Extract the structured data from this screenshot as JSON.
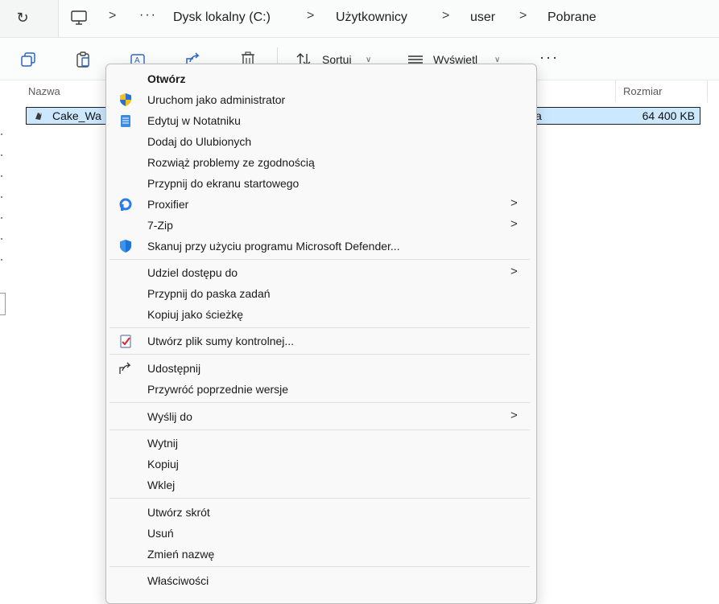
{
  "address": {
    "crumbs": [
      "Dysk lokalny (C:)",
      "Użytkownicy",
      "user",
      "Pobrane"
    ],
    "separator": ">",
    "more": "···"
  },
  "toolbar": {
    "sort_label": "Sortuj",
    "view_label": "Wyświetl",
    "more": "···"
  },
  "columns": {
    "name": "Nazwa",
    "size": "Rozmiar"
  },
  "file": {
    "name": "Cake_Wa",
    "type_fragment": "a",
    "size": "64 400 KB"
  },
  "menu": {
    "items": [
      {
        "label": "Otwórz",
        "bold": true
      },
      {
        "label": "Uruchom jako administrator",
        "icon": "uac-shield-icon"
      },
      {
        "label": "Edytuj w Notatniku",
        "icon": "notepad-icon"
      },
      {
        "label": "Dodaj do Ulubionych"
      },
      {
        "label": "Rozwiąż problemy ze zgodnością"
      },
      {
        "label": "Przypnij do ekranu startowego"
      },
      {
        "label": "Proxifier",
        "icon": "proxifier-icon",
        "submenu": true
      },
      {
        "label": "7-Zip",
        "submenu": true
      },
      {
        "label": "Skanuj przy użyciu programu Microsoft Defender...",
        "icon": "defender-shield-icon"
      },
      {
        "label": "Udziel dostępu do",
        "submenu": true
      },
      {
        "label": "Przypnij do paska zadań"
      },
      {
        "label": "Kopiuj jako ścieżkę"
      },
      {
        "label": "Utwórz plik sumy kontrolnej...",
        "icon": "checksum-icon"
      },
      {
        "label": "Udostępnij",
        "icon": "share-icon"
      },
      {
        "label": "Przywróć poprzednie wersje"
      },
      {
        "label": "Wyślij do",
        "submenu": true
      },
      {
        "label": "Wytnij"
      },
      {
        "label": "Kopiuj"
      },
      {
        "label": "Wklej"
      },
      {
        "label": "Utwórz skrót"
      },
      {
        "label": "Usuń"
      },
      {
        "label": "Zmień nazwę"
      },
      {
        "label": "Właściwości"
      }
    ],
    "chevron": ">"
  },
  "colors": {
    "selection": "#cce8ff",
    "defender": "#1e73d9",
    "menu_bg": "#f9f9f9"
  }
}
